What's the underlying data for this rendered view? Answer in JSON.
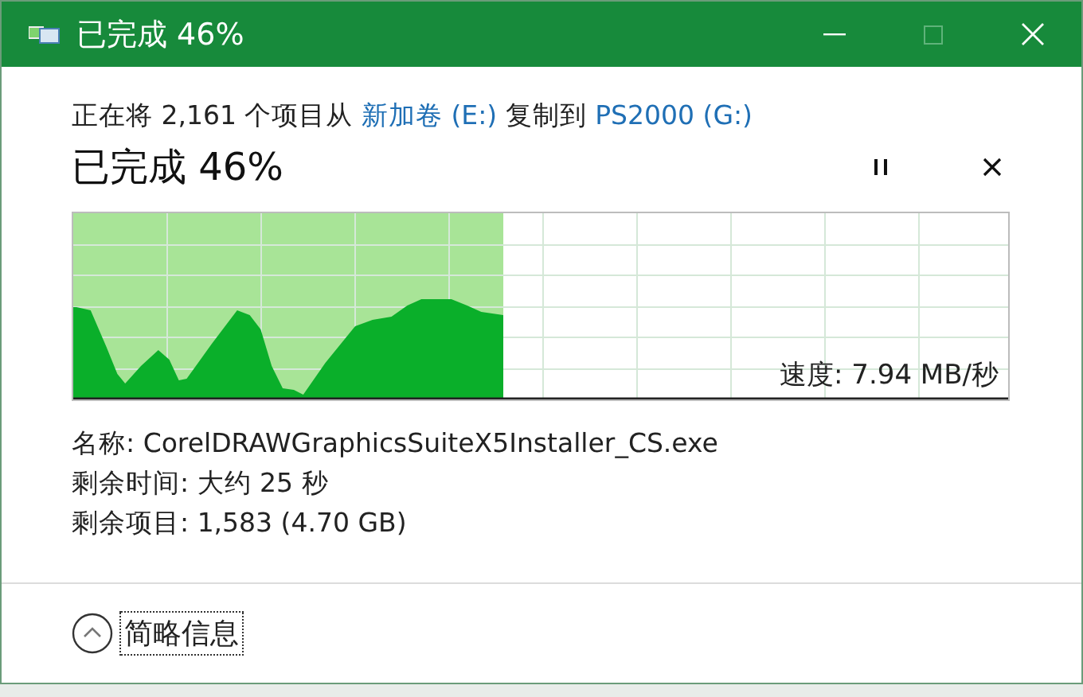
{
  "window": {
    "title": "已完成 46%"
  },
  "copy_line": {
    "prefix": "正在将 2,161 个项目从 ",
    "source": "新加卷 (E:)",
    "middle": " 复制到 ",
    "destination": "PS2000 (G:)"
  },
  "progress": {
    "text": "已完成 46%",
    "level": 0.46,
    "speed": "速度: 7.94 MB/秒"
  },
  "details": [
    {
      "label": "名称:",
      "value": "CorelDRAWGraphicsSuiteX5Installer_CS.exe"
    },
    {
      "label": "剩余时间:",
      "value": "大约 25 秒"
    },
    {
      "label": "剩余项目:",
      "value": "1,583 (4.70 GB)"
    }
  ],
  "footer": {
    "toggle": "简略信息",
    "expanded": true
  }
}
